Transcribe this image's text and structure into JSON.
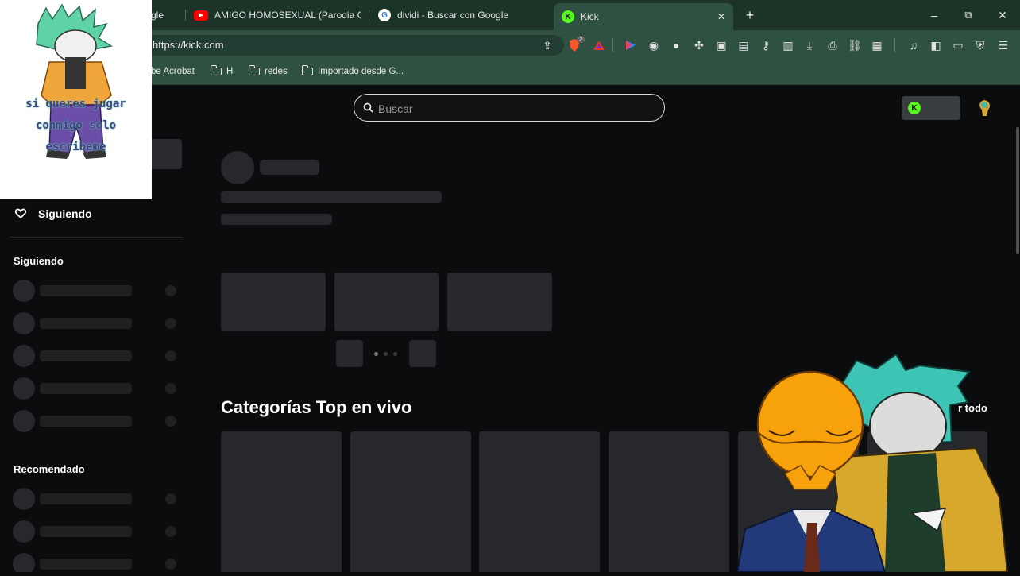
{
  "tabs": [
    {
      "label": "gle",
      "favicon": "google-icon",
      "active": false
    },
    {
      "label": "AMIGO HOMOSEXUAL (Parodia Chay",
      "favicon": "youtube-icon",
      "active": false
    },
    {
      "label": "dividi - Buscar con Google",
      "favicon": "google-icon",
      "active": false
    },
    {
      "label": "Kick",
      "favicon": "kick-icon",
      "active": true
    }
  ],
  "tab_controls": {
    "close": "✕",
    "new_tab": "+"
  },
  "window_controls": {
    "minimize": "–",
    "restore": "⧉",
    "close": "✕"
  },
  "address_bar": {
    "url": "https://kick.com",
    "brave_badge": "2"
  },
  "bookmarks": [
    {
      "label": "be Acrobat",
      "type": "link"
    },
    {
      "label": "H",
      "type": "folder"
    },
    {
      "label": "redes",
      "type": "folder"
    },
    {
      "label": "Importado desde G...",
      "type": "folder"
    }
  ],
  "kick": {
    "search_placeholder": "Buscar",
    "sidebar": {
      "following_nav": "Siguiendo",
      "following_heading": "Siguiendo",
      "recommended_heading": "Recomendado"
    },
    "categories_title": "Categorías Top en vivo",
    "see_all_partial": "r todo"
  },
  "overlays": {
    "top_left_caption": "si queres jugar conmigo solo escribeme"
  },
  "colors": {
    "browser_frame": "#1c3328",
    "toolbar": "#2f5142",
    "page_bg": "#0b0c0d",
    "skeleton": "#26282b",
    "kick_green": "#53fc18"
  }
}
